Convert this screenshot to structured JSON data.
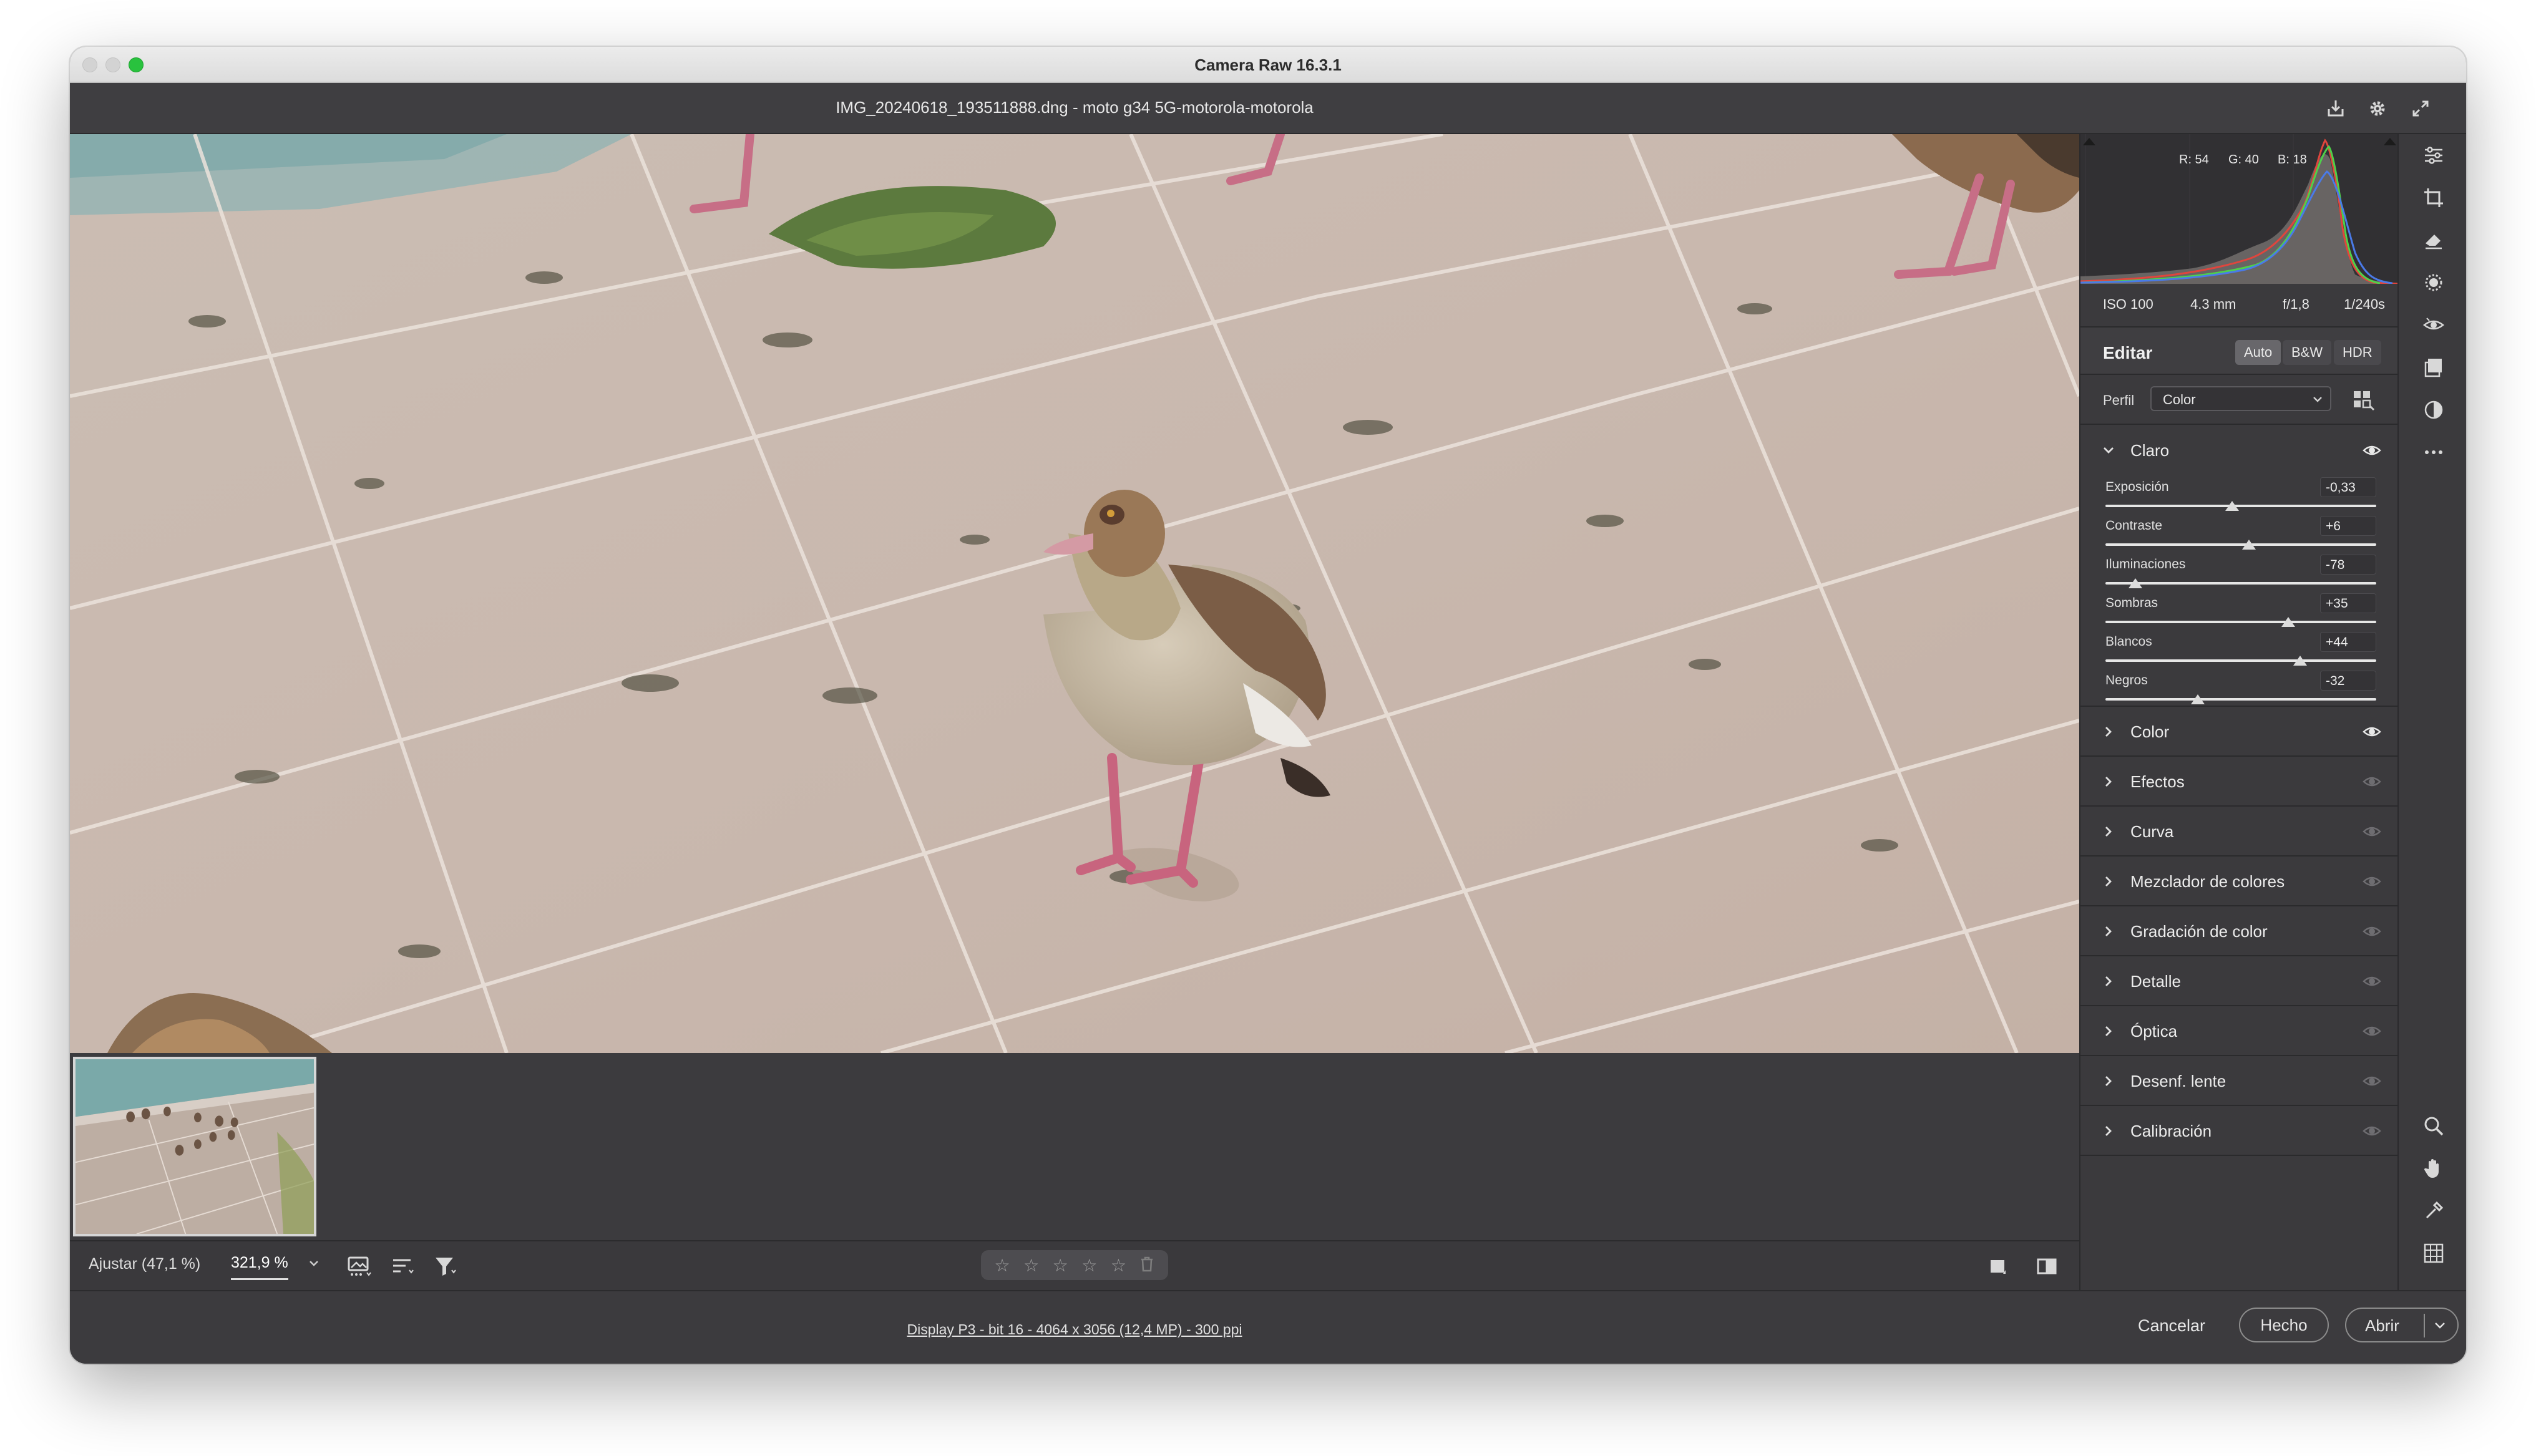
{
  "window": {
    "title": "Camera Raw 16.3.1",
    "document_title": "IMG_20240618_193511888.dng -  moto g34 5G-motorola-motorola"
  },
  "histogram": {
    "r_label": "R: 54",
    "g_label": "G: 40",
    "b_label": "B: 18"
  },
  "exif": {
    "iso": "ISO 100",
    "focal": "4.3 mm",
    "aperture": "f/1,8",
    "shutter": "1/240s"
  },
  "edit": {
    "title": "Editar",
    "auto": "Auto",
    "bw": "B&W",
    "hdr": "HDR",
    "profile_label": "Perfil",
    "profile_value": "Color"
  },
  "light": {
    "title": "Claro",
    "sliders": [
      {
        "label": "Exposición",
        "value": "-0,33",
        "fraction": 0.467
      },
      {
        "label": "Contraste",
        "value": "+6",
        "fraction": 0.53
      },
      {
        "label": "Iluminaciones",
        "value": "-78",
        "fraction": 0.11
      },
      {
        "label": "Sombras",
        "value": "+35",
        "fraction": 0.675
      },
      {
        "label": "Blancos",
        "value": "+44",
        "fraction": 0.72
      },
      {
        "label": "Negros",
        "value": "-32",
        "fraction": 0.34
      }
    ]
  },
  "sections": [
    {
      "label": "Color"
    },
    {
      "label": "Efectos"
    },
    {
      "label": "Curva"
    },
    {
      "label": "Mezclador de colores"
    },
    {
      "label": "Gradación de color"
    },
    {
      "label": "Detalle"
    },
    {
      "label": "Óptica"
    },
    {
      "label": "Desenf. lente"
    },
    {
      "label": "Calibración"
    }
  ],
  "bottom": {
    "fit_label": "Ajustar (47,1 %)",
    "zoom_value": "321,9 %",
    "stars": [
      "☆",
      "☆",
      "☆",
      "☆",
      "☆"
    ],
    "trash": "🗑"
  },
  "footer": {
    "info": "Display P3 - bit 16 - 4064 x 3056 (12,4 MP) - 300 ppi",
    "cancel": "Cancelar",
    "done": "Hecho",
    "open": "Abrir"
  },
  "colors": {
    "panel_bg": "#3b3a3d",
    "accent_max": "#29c23e",
    "text": "#ececec"
  },
  "icons": {
    "top": [
      "save-icon",
      "gear-icon",
      "fullscreen-icon"
    ],
    "tools": [
      "edit-sliders-icon",
      "crop-icon",
      "eraser-icon",
      "masking-icon",
      "red-eye-icon",
      "presets-icon",
      "snapshot-icon",
      "more-icon",
      "zoom-icon",
      "hand-icon",
      "color-sampler-icon",
      "grid-icon"
    ]
  }
}
